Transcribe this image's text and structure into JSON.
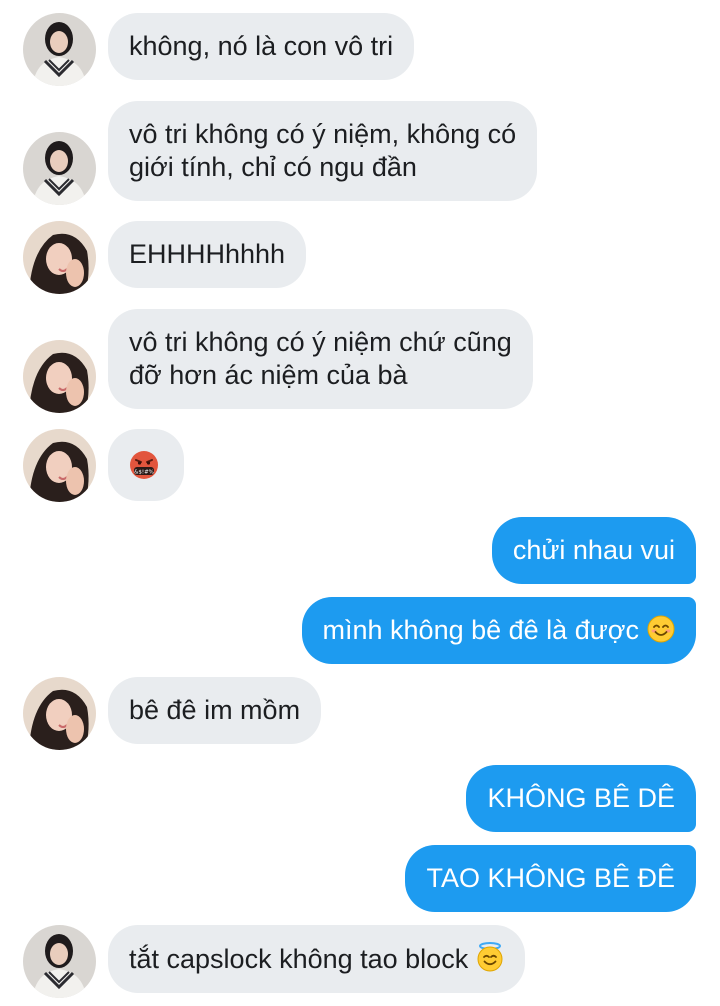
{
  "conversation": {
    "messages": [
      {
        "text": "không, nó là con vô tri"
      },
      {
        "line1": "vô tri không có ý niệm, không có",
        "line2": "giới tính, chỉ có ngu đần"
      },
      {
        "text": "EHHHHhhhh"
      },
      {
        "line1": "vô tri không có ý niệm chứ cũng",
        "line2": "đỡ hơn ác niệm của bà"
      },
      {
        "emoji": "face-with-symbols-on-mouth",
        "emoji_text": "&$!#%"
      },
      {
        "text": "chửi nhau vui"
      },
      {
        "text": "mình không bê đê là được",
        "emoji": "smiling-face-with-smiling-eyes"
      },
      {
        "text": "bê đê im mồm"
      },
      {
        "text": "KHÔNG BÊ DÊ"
      },
      {
        "text": "TAO KHÔNG BÊ ĐÊ"
      },
      {
        "text": "tắt capslock không tao block",
        "emoji": "smiling-face-with-halo"
      }
    ]
  },
  "colors": {
    "incoming_bubble": "#e9ecef",
    "outgoing_bubble": "#1d9bf0",
    "incoming_text": "#1c1e21",
    "outgoing_text": "#ffffff"
  }
}
